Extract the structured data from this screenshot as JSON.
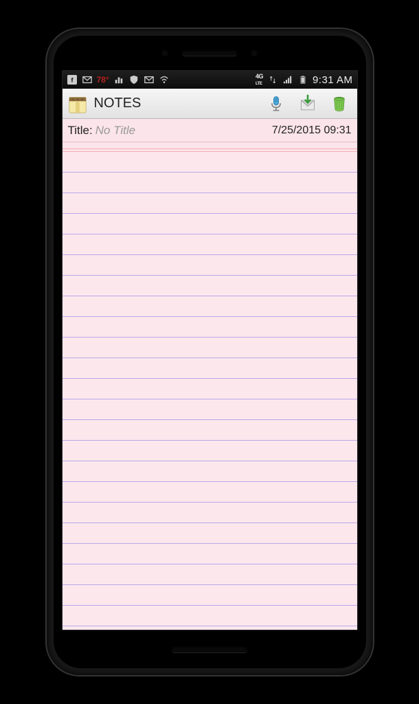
{
  "status_bar": {
    "temperature": "78°",
    "network_label": "4G LTE",
    "time": "9:31 AM"
  },
  "app_bar": {
    "title": "NOTES"
  },
  "note": {
    "title_label": "Title:",
    "title_placeholder": "No Title",
    "title_value": "",
    "timestamp": "7/25/2015 09:31"
  }
}
